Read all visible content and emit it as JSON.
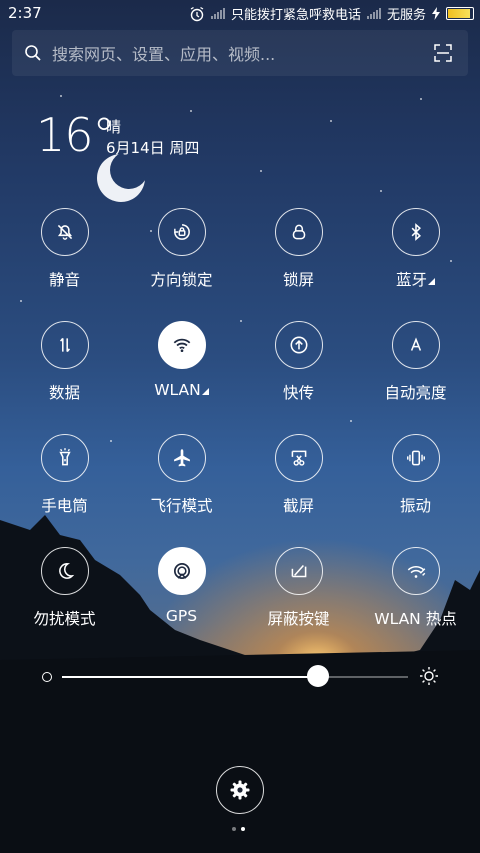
{
  "status": {
    "time": "2:37",
    "carrier_text": "只能拨打紧急呼救电话",
    "service_text": "无服务",
    "icons": [
      "alarm-icon",
      "signal-icon",
      "signal-icon",
      "charging-icon",
      "battery-icon"
    ]
  },
  "search": {
    "placeholder": "搜索网页、设置、应用、视频...",
    "left_icon": "search-icon",
    "right_icon": "scan-icon"
  },
  "weather": {
    "temperature": "16°",
    "condition": "晴",
    "date": "6月14日 周四",
    "icon": "moon-icon"
  },
  "toggles": [
    {
      "label": "静音",
      "icon": "bell-mute-icon",
      "active": false
    },
    {
      "label": "方向锁定",
      "icon": "rotation-lock-icon",
      "active": false
    },
    {
      "label": "锁屏",
      "icon": "lock-icon",
      "active": false
    },
    {
      "label": "蓝牙",
      "icon": "bluetooth-icon",
      "active": false,
      "has_menu": true
    },
    {
      "label": "数据",
      "icon": "mobile-data-icon",
      "active": false
    },
    {
      "label": "WLAN",
      "icon": "wifi-icon",
      "active": true,
      "has_menu": true
    },
    {
      "label": "快传",
      "icon": "quick-send-icon",
      "active": false
    },
    {
      "label": "自动亮度",
      "icon": "auto-brightness-icon",
      "active": false
    },
    {
      "label": "手电筒",
      "icon": "flashlight-icon",
      "active": false
    },
    {
      "label": "飞行模式",
      "icon": "airplane-icon",
      "active": false
    },
    {
      "label": "截屏",
      "icon": "screenshot-icon",
      "active": false
    },
    {
      "label": "振动",
      "icon": "vibrate-icon",
      "active": false
    },
    {
      "label": "勿扰模式",
      "icon": "moon-dnd-icon",
      "active": false
    },
    {
      "label": "GPS",
      "icon": "gps-icon",
      "active": true
    },
    {
      "label": "屏蔽按键",
      "icon": "block-keys-icon",
      "active": false
    },
    {
      "label": "WLAN 热点",
      "icon": "hotspot-icon",
      "active": false
    }
  ],
  "brightness": {
    "level": 0.74,
    "min_icon": "dim-icon",
    "max_icon": "sun-icon"
  },
  "settings": {
    "icon": "gear-icon"
  },
  "pager": {
    "pages": 2,
    "current": 2
  }
}
